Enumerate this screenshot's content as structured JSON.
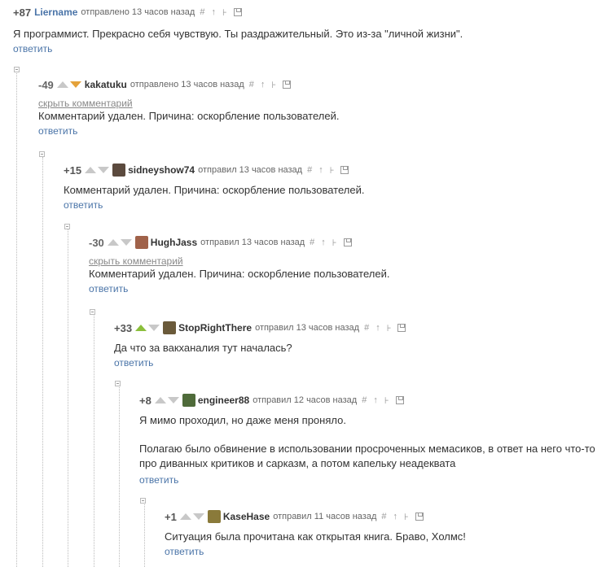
{
  "common": {
    "reply": "ответить",
    "hide": "скрыть комментарий",
    "deleted": "Комментарий удален. Причина: оскорбление пользователей.",
    "actions": [
      "#",
      "↑",
      "⊦"
    ]
  },
  "c1": {
    "score": "+87",
    "author": "Liername",
    "meta": "отправлено 13 часов назад",
    "text": "Я программист. Прекрасно себя чувствую. Ты раздражительный. Это из-за \"личной жизни\"."
  },
  "c2": {
    "score": "-49",
    "author": "kakatuku",
    "meta": "отправлено 13 часов назад"
  },
  "c3": {
    "score": "+15",
    "author": "sidneyshow74",
    "meta": "отправил 13 часов назад"
  },
  "c4": {
    "score": "-30",
    "author": "HughJass",
    "meta": "отправил 13 часов назад"
  },
  "c5": {
    "score": "+33",
    "author": "StopRightThere",
    "meta": "отправил 13 часов назад",
    "text": "Да что за вакханалия тут началась?"
  },
  "c6": {
    "score": "+8",
    "author": "engineer88",
    "meta": "отправил 12 часов назад",
    "text1": "Я мимо проходил, но даже меня проняло.",
    "text2": "Полагаю было обвинение в использовании просроченных мемасиков, в ответ на него что-то про диванных критиков и сарказм, а потом капельку неадеквата"
  },
  "c7": {
    "score": "+1",
    "author": "KaseHase",
    "meta": "отправил 11 часов назад",
    "text": "Ситуация была прочитана как открытая книга. Браво, Холмс!"
  },
  "colors": {
    "link": "#4a74a8",
    "upvote": "#8bbf3c",
    "downvote": "#e4a23a"
  }
}
